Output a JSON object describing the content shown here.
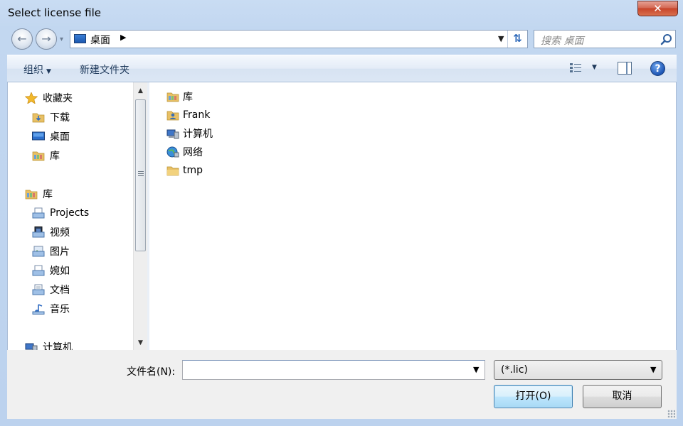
{
  "window": {
    "title": "Select license file",
    "close_label": "✕"
  },
  "nav": {
    "back_glyph": "←",
    "forward_glyph": "→",
    "dropdown_glyph": "▾"
  },
  "address": {
    "location": "桌面",
    "separator": "▶",
    "dropdown_glyph": "▼",
    "refresh_glyph": "⇅"
  },
  "search": {
    "placeholder": "搜索 桌面"
  },
  "commandbar": {
    "organize": "组织",
    "organize_caret": "▼",
    "new_folder": "新建文件夹",
    "view_caret": "▼",
    "help": "?"
  },
  "sidebar": {
    "items": [
      {
        "label": "收藏夹",
        "icon": "star-icon"
      },
      {
        "label": "下载",
        "icon": "downloads-folder-icon"
      },
      {
        "label": "桌面",
        "icon": "desktop-icon"
      },
      {
        "label": "库",
        "icon": "library-icon"
      },
      {
        "label": "库",
        "icon": "library-icon"
      },
      {
        "label": "Projects",
        "icon": "library-docs-icon"
      },
      {
        "label": "视频",
        "icon": "video-library-icon"
      },
      {
        "label": "图片",
        "icon": "pictures-library-icon"
      },
      {
        "label": "婉如",
        "icon": "library-docs-icon"
      },
      {
        "label": "文档",
        "icon": "documents-library-icon"
      },
      {
        "label": "音乐",
        "icon": "music-library-icon"
      },
      {
        "label": "计算机",
        "icon": "computer-icon"
      }
    ]
  },
  "scrollbar": {
    "up_glyph": "▲",
    "down_glyph": "▼"
  },
  "files": {
    "items": [
      {
        "label": "库",
        "icon": "library-icon"
      },
      {
        "label": "Frank",
        "icon": "user-folder-icon"
      },
      {
        "label": "计算机",
        "icon": "computer-icon"
      },
      {
        "label": "网络",
        "icon": "network-icon"
      },
      {
        "label": "tmp",
        "icon": "folder-icon"
      }
    ]
  },
  "footer": {
    "filename_label": "文件名(N):",
    "filename_value": "",
    "filename_dropdown_glyph": "▼",
    "filter_value": "(*.lic)",
    "filter_dropdown_glyph": "▼",
    "open_label": "打开(O)",
    "cancel_label": "取消"
  },
  "colors": {
    "frame": "#bcd2ee",
    "accent": "#1e395b",
    "close": "#c7452a",
    "folder": "#e8c065"
  }
}
